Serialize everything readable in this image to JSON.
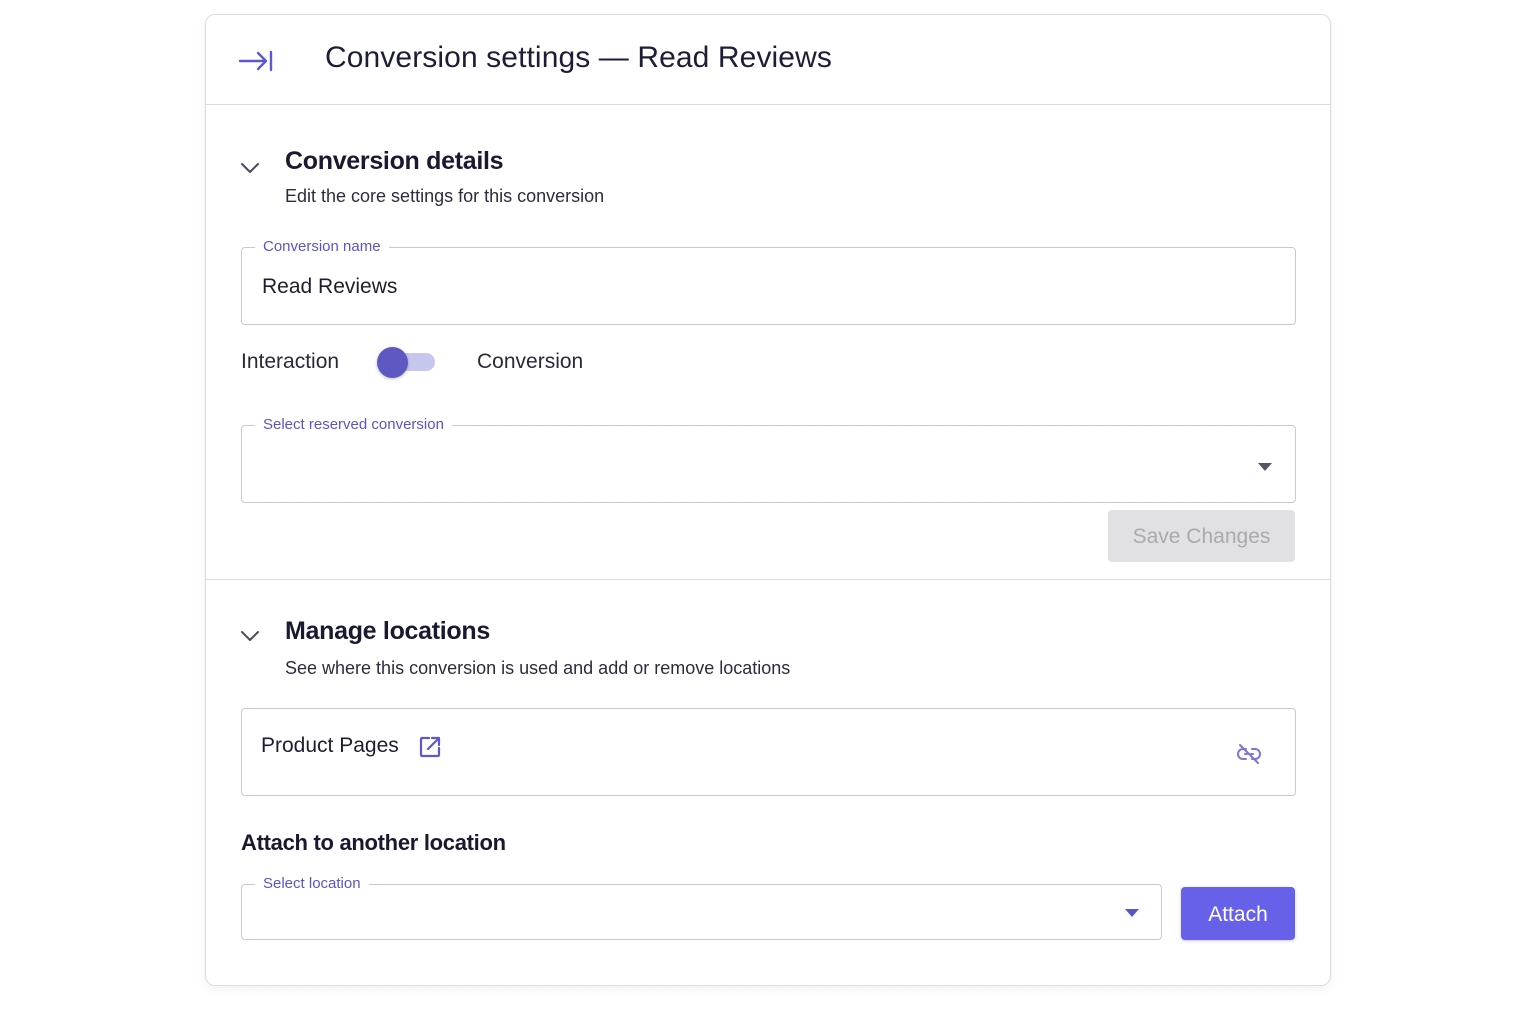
{
  "header": {
    "title": "Conversion settings — Read Reviews",
    "collapse_icon": "collapse-panel-icon"
  },
  "details_section": {
    "title": "Conversion details",
    "subtitle": "Edit the core settings for this conversion",
    "name_field": {
      "label": "Conversion name",
      "value": "Read Reviews"
    },
    "type_toggle": {
      "left_label": "Interaction",
      "right_label": "Conversion",
      "state": "Interaction"
    },
    "reserved_select": {
      "label": "Select reserved conversion",
      "value": ""
    },
    "save_button_label": "Save Changes",
    "save_button_state": "disabled"
  },
  "locations_section": {
    "title": "Manage locations",
    "subtitle": "See where this conversion is used and add or remove locations",
    "locations": [
      {
        "name": "Product Pages"
      }
    ],
    "attach_heading": "Attach to another location",
    "location_select": {
      "label": "Select location",
      "value": ""
    },
    "attach_button_label": "Attach"
  },
  "colors": {
    "accent": "#6661e8",
    "toggle_knob": "#5e58c2",
    "toggle_track": "#c7c6ef",
    "label": "#5a55c6",
    "border": "#c9c9d2",
    "disabled_bg": "#e1e1e4",
    "disabled_text": "#a9a9b0"
  }
}
